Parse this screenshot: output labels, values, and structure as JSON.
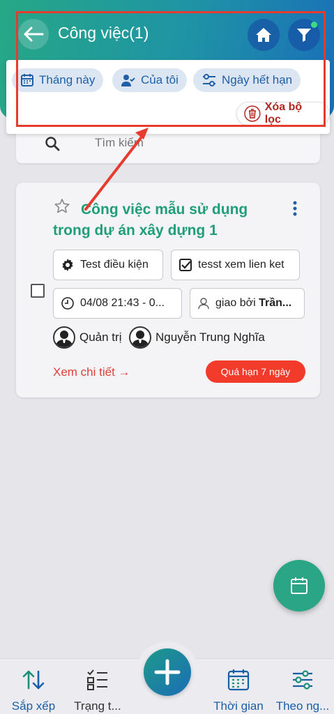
{
  "header": {
    "title": "Công việc(1)",
    "back_icon": "arrow-left-icon",
    "home_icon": "home-icon",
    "filter_icon": "filter-icon"
  },
  "filter_chips": [
    {
      "label": "Tháng này",
      "icon": "calendar-icon"
    },
    {
      "label": "Của tôi",
      "icon": "user-check-icon"
    },
    {
      "label": "Ngày hết hạn",
      "icon": "sliders-icon"
    }
  ],
  "clear_filter": {
    "label": "Xóa bộ lọc",
    "icon": "trash-icon"
  },
  "search": {
    "placeholder": "Tìm kiếm"
  },
  "task": {
    "title": "Công việc mẫu sử dụng trong dự án xây dựng 1",
    "tags": [
      {
        "label": "Test điều kiện",
        "icon": "gear-icon"
      },
      {
        "label": "tesst xem lien ket",
        "icon": "checkbox-icon"
      }
    ],
    "time": "04/08 21:43 - 0...",
    "assigned_prefix": "giao bởi ",
    "assigned_by": "Trần...",
    "people": [
      "Quản trị",
      "Nguyễn Trung Nghĩa"
    ],
    "detail_link": "Xem chi tiết →",
    "status_badge": "Quá hạn 7 ngày"
  },
  "bottom_nav": [
    {
      "label": "Sắp xếp",
      "icon": "sort-icon"
    },
    {
      "label": "Trạng t...",
      "icon": "checklist-icon"
    },
    {
      "label": "Thời gian",
      "icon": "calendar-grid-icon"
    },
    {
      "label": "Theo ng...",
      "icon": "sliders-icon"
    }
  ],
  "colors": {
    "accent_green": "#1f9e78",
    "accent_blue": "#1a5fa6",
    "danger_red": "#f23b2a",
    "annotation_red": "#e63b2e"
  }
}
